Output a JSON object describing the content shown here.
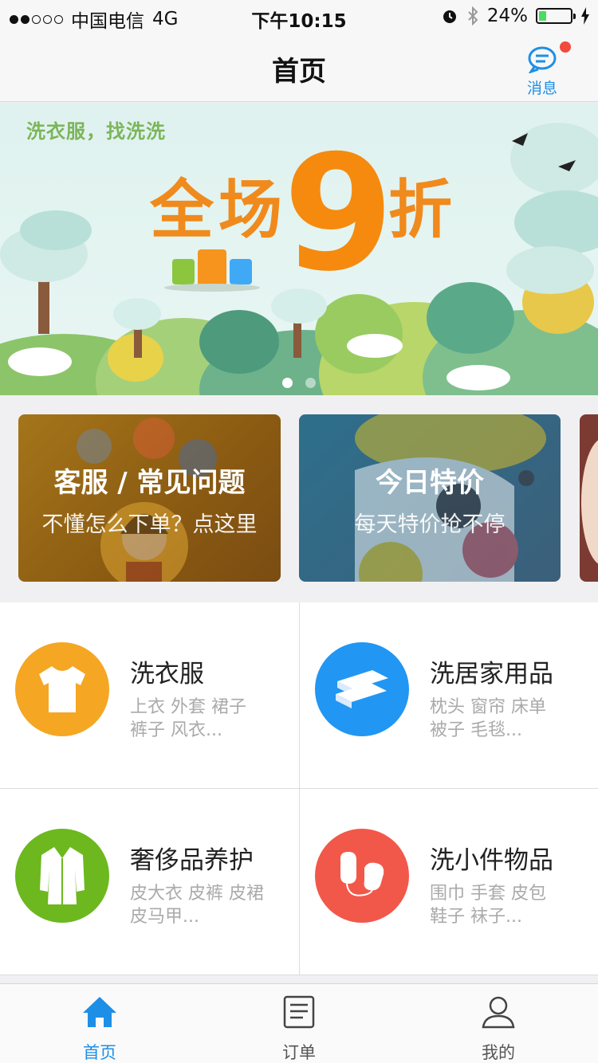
{
  "status_bar": {
    "carrier": "中国电信",
    "network": "4G",
    "time": "下午10:15",
    "battery": "24%"
  },
  "navbar": {
    "title": "首页",
    "messages_label": "消息"
  },
  "banner": {
    "slogan": "洗衣服，找洗洗",
    "promo_prefix": "全场",
    "promo_number": "9",
    "promo_suffix": "折"
  },
  "cards": [
    {
      "title": "客服 / 常见问题",
      "subtitle": "不懂怎么下单？点这里"
    },
    {
      "title": "今日特价",
      "subtitle": "每天特价抢不停"
    }
  ],
  "services": [
    {
      "name": "洗衣服",
      "desc_line1": "上衣 外套 裙子",
      "desc_line2": "裤子 风衣...",
      "color": "#f5a623"
    },
    {
      "name": "洗居家用品",
      "desc_line1": "枕头 窗帘 床单",
      "desc_line2": "被子 毛毯...",
      "color": "#2196f3"
    },
    {
      "name": "奢侈品养护",
      "desc_line1": "皮大衣 皮裤 皮裙",
      "desc_line2": "皮马甲...",
      "color": "#6cb81e"
    },
    {
      "name": "洗小件物品",
      "desc_line1": "围巾 手套 皮包",
      "desc_line2": "鞋子 袜子...",
      "color": "#f2584a"
    }
  ],
  "tabbar": {
    "items": [
      {
        "label": "首页",
        "icon": "home-icon",
        "active": true
      },
      {
        "label": "订单",
        "icon": "order-icon",
        "active": false
      },
      {
        "label": "我的",
        "icon": "profile-icon",
        "active": false
      }
    ]
  },
  "colors": {
    "accent": "#1e8fe6",
    "badge": "#f24a3e",
    "promo": "#f08a1c"
  }
}
